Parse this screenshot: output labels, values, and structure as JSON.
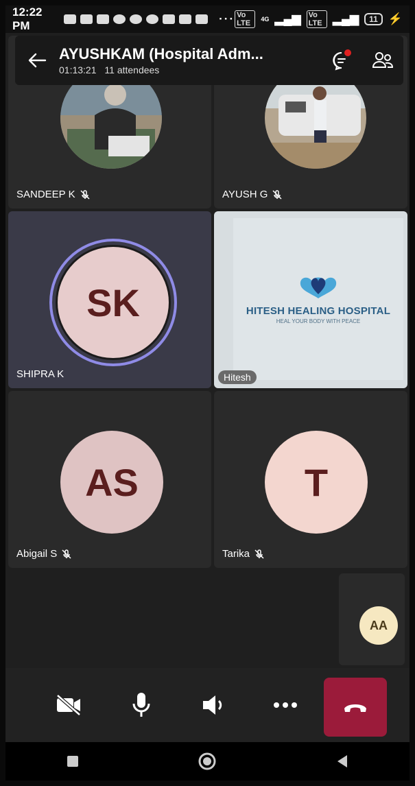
{
  "status_bar": {
    "time": "12:22 PM",
    "network_1": "Vo LTE",
    "network_2": "Vo LTE",
    "signal_label": "4G",
    "battery": "11"
  },
  "meeting": {
    "title": "AYUSHKAM (Hospital Adm...",
    "duration": "01:13:21",
    "attendees": "11 attendees"
  },
  "participants": [
    {
      "name": "SANDEEP K",
      "muted": true
    },
    {
      "name": "AYUSH G",
      "muted": true
    },
    {
      "name": "SHIPRA K",
      "initials": "SK",
      "muted": false
    },
    {
      "name": "Hitesh",
      "muted": false
    },
    {
      "name": "Abigail S",
      "initials": "AS",
      "muted": true
    },
    {
      "name": "Tarika",
      "initials": "T",
      "muted": true
    }
  ],
  "shared_brand": {
    "name": "HITESH HEALING HOSPITAL",
    "tagline": "HEAL YOUR BODY WITH PEACE"
  },
  "extra_participant": {
    "initials": "AA"
  },
  "colors": {
    "end_call": "#9b1b3a",
    "active_speaker_ring": "#8f8be6",
    "notification_dot": "#e02020"
  },
  "icons": [
    "back-arrow-icon",
    "chat-icon",
    "people-icon",
    "camera-off-icon",
    "microphone-icon",
    "speaker-icon",
    "more-icon",
    "end-call-icon",
    "mic-off-icon"
  ]
}
